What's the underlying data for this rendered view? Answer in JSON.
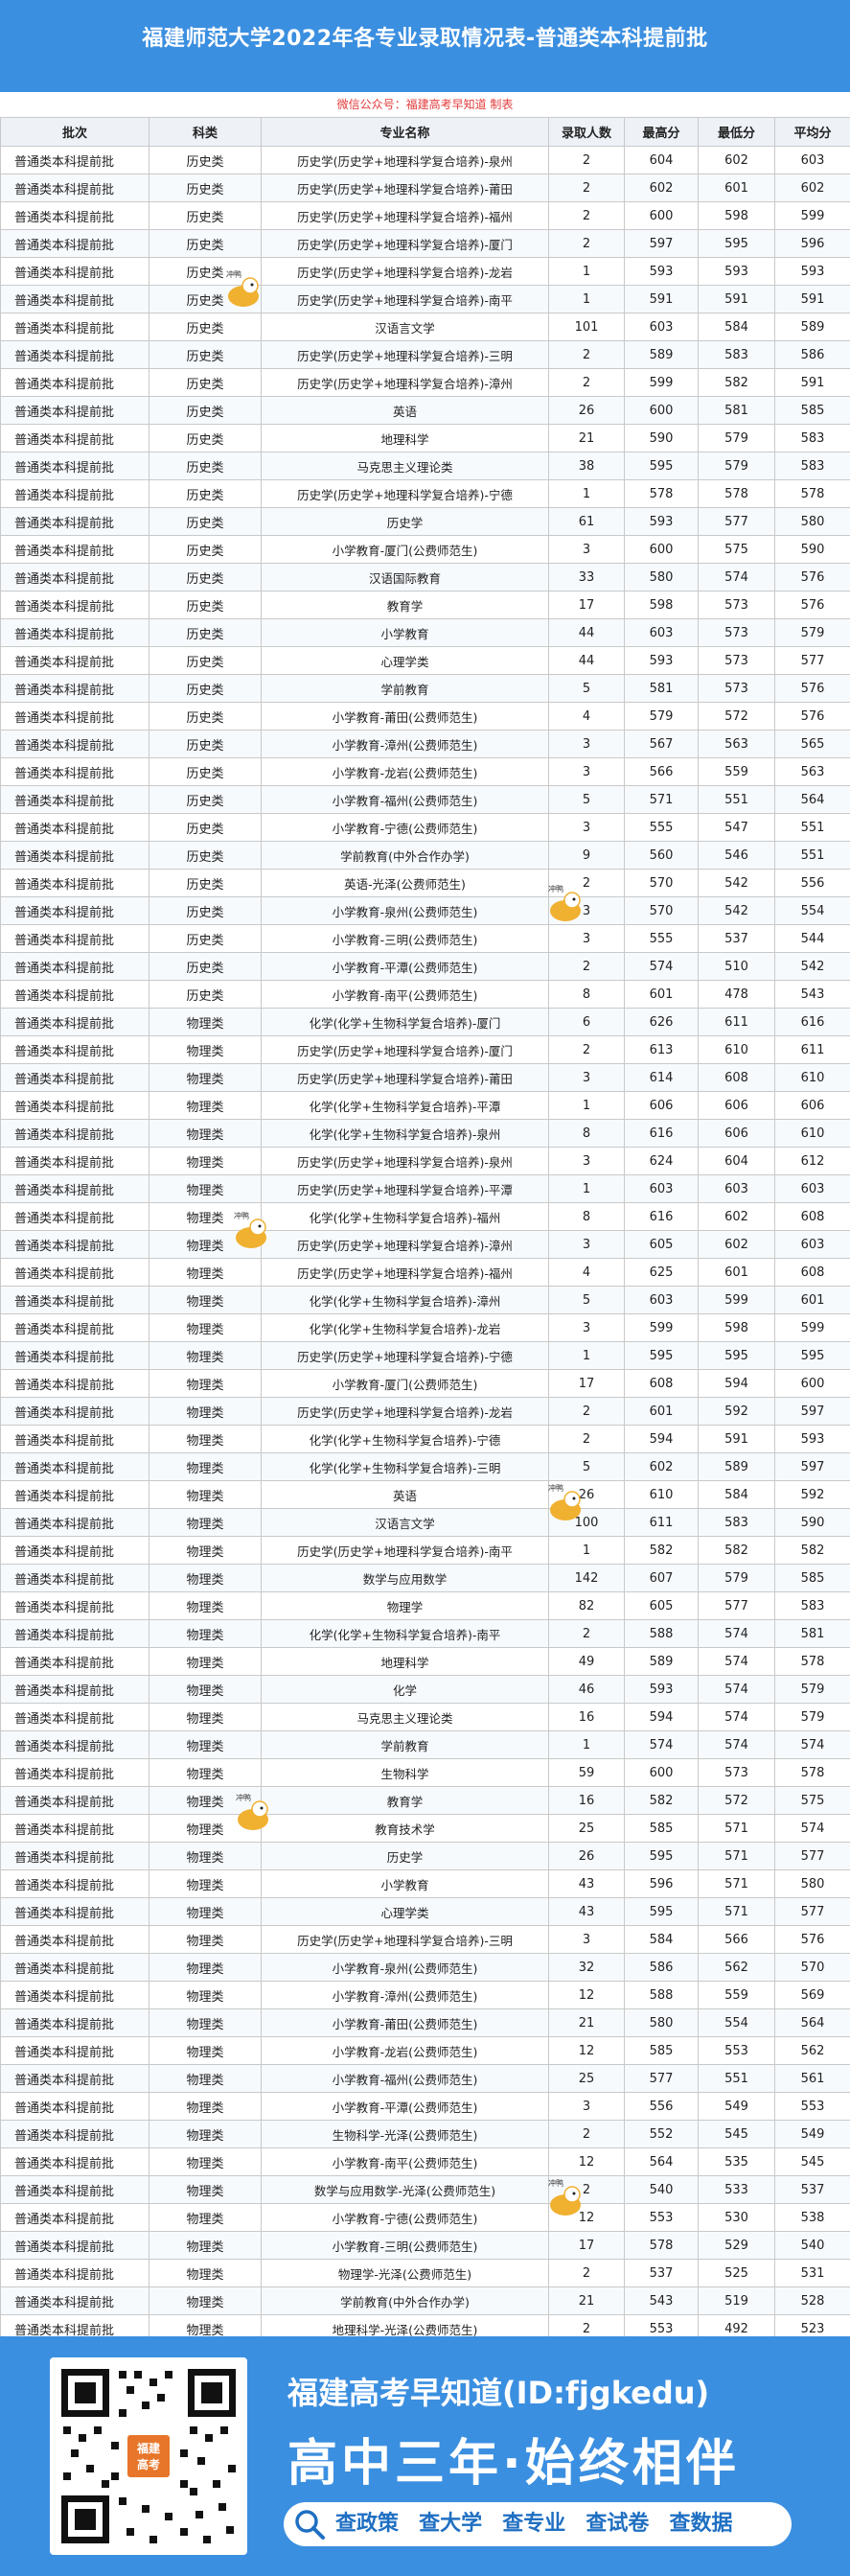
{
  "header": {
    "title": "福建师范大学2022年各专业录取情况表-普通类本科提前批",
    "subtitle": "微信公众号：福建高考早知道 制表"
  },
  "table": {
    "columns": [
      "批次",
      "科类",
      "专业名称",
      "录取人数",
      "最高分",
      "最低分",
      "平均分"
    ],
    "rows": [
      [
        "普通类本科提前批",
        "历史类",
        "历史学(历史学+地理科学复合培养)-泉州",
        "2",
        "604",
        "602",
        "603"
      ],
      [
        "普通类本科提前批",
        "历史类",
        "历史学(历史学+地理科学复合培养)-莆田",
        "2",
        "602",
        "601",
        "602"
      ],
      [
        "普通类本科提前批",
        "历史类",
        "历史学(历史学+地理科学复合培养)-福州",
        "2",
        "600",
        "598",
        "599"
      ],
      [
        "普通类本科提前批",
        "历史类",
        "历史学(历史学+地理科学复合培养)-厦门",
        "2",
        "597",
        "595",
        "596"
      ],
      [
        "普通类本科提前批",
        "历史类",
        "历史学(历史学+地理科学复合培养)-龙岩",
        "1",
        "593",
        "593",
        "593"
      ],
      [
        "普通类本科提前批",
        "历史类",
        "历史学(历史学+地理科学复合培养)-南平",
        "1",
        "591",
        "591",
        "591"
      ],
      [
        "普通类本科提前批",
        "历史类",
        "汉语言文学",
        "101",
        "603",
        "584",
        "589"
      ],
      [
        "普通类本科提前批",
        "历史类",
        "历史学(历史学+地理科学复合培养)-三明",
        "2",
        "589",
        "583",
        "586"
      ],
      [
        "普通类本科提前批",
        "历史类",
        "历史学(历史学+地理科学复合培养)-漳州",
        "2",
        "599",
        "582",
        "591"
      ],
      [
        "普通类本科提前批",
        "历史类",
        "英语",
        "26",
        "600",
        "581",
        "585"
      ],
      [
        "普通类本科提前批",
        "历史类",
        "地理科学",
        "21",
        "590",
        "579",
        "583"
      ],
      [
        "普通类本科提前批",
        "历史类",
        "马克思主义理论类",
        "38",
        "595",
        "579",
        "583"
      ],
      [
        "普通类本科提前批",
        "历史类",
        "历史学(历史学+地理科学复合培养)-宁德",
        "1",
        "578",
        "578",
        "578"
      ],
      [
        "普通类本科提前批",
        "历史类",
        "历史学",
        "61",
        "593",
        "577",
        "580"
      ],
      [
        "普通类本科提前批",
        "历史类",
        "小学教育-厦门(公费师范生)",
        "3",
        "600",
        "575",
        "590"
      ],
      [
        "普通类本科提前批",
        "历史类",
        "汉语国际教育",
        "33",
        "580",
        "574",
        "576"
      ],
      [
        "普通类本科提前批",
        "历史类",
        "教育学",
        "17",
        "598",
        "573",
        "576"
      ],
      [
        "普通类本科提前批",
        "历史类",
        "小学教育",
        "44",
        "603",
        "573",
        "579"
      ],
      [
        "普通类本科提前批",
        "历史类",
        "心理学类",
        "44",
        "593",
        "573",
        "577"
      ],
      [
        "普通类本科提前批",
        "历史类",
        "学前教育",
        "5",
        "581",
        "573",
        "576"
      ],
      [
        "普通类本科提前批",
        "历史类",
        "小学教育-莆田(公费师范生)",
        "4",
        "579",
        "572",
        "576"
      ],
      [
        "普通类本科提前批",
        "历史类",
        "小学教育-漳州(公费师范生)",
        "3",
        "567",
        "563",
        "565"
      ],
      [
        "普通类本科提前批",
        "历史类",
        "小学教育-龙岩(公费师范生)",
        "3",
        "566",
        "559",
        "563"
      ],
      [
        "普通类本科提前批",
        "历史类",
        "小学教育-福州(公费师范生)",
        "5",
        "571",
        "551",
        "564"
      ],
      [
        "普通类本科提前批",
        "历史类",
        "小学教育-宁德(公费师范生)",
        "3",
        "555",
        "547",
        "551"
      ],
      [
        "普通类本科提前批",
        "历史类",
        "学前教育(中外合作办学)",
        "9",
        "560",
        "546",
        "551"
      ],
      [
        "普通类本科提前批",
        "历史类",
        "英语-光泽(公费师范生)",
        "2",
        "570",
        "542",
        "556"
      ],
      [
        "普通类本科提前批",
        "历史类",
        "小学教育-泉州(公费师范生)",
        "3",
        "570",
        "542",
        "554"
      ],
      [
        "普通类本科提前批",
        "历史类",
        "小学教育-三明(公费师范生)",
        "3",
        "555",
        "537",
        "544"
      ],
      [
        "普通类本科提前批",
        "历史类",
        "小学教育-平潭(公费师范生)",
        "2",
        "574",
        "510",
        "542"
      ],
      [
        "普通类本科提前批",
        "历史类",
        "小学教育-南平(公费师范生)",
        "8",
        "601",
        "478",
        "543"
      ],
      [
        "普通类本科提前批",
        "物理类",
        "化学(化学+生物科学复合培养)-厦门",
        "6",
        "626",
        "611",
        "616"
      ],
      [
        "普通类本科提前批",
        "物理类",
        "历史学(历史学+地理科学复合培养)-厦门",
        "2",
        "613",
        "610",
        "611"
      ],
      [
        "普通类本科提前批",
        "物理类",
        "历史学(历史学+地理科学复合培养)-莆田",
        "3",
        "614",
        "608",
        "610"
      ],
      [
        "普通类本科提前批",
        "物理类",
        "化学(化学+生物科学复合培养)-平潭",
        "1",
        "606",
        "606",
        "606"
      ],
      [
        "普通类本科提前批",
        "物理类",
        "化学(化学+生物科学复合培养)-泉州",
        "8",
        "616",
        "606",
        "610"
      ],
      [
        "普通类本科提前批",
        "物理类",
        "历史学(历史学+地理科学复合培养)-泉州",
        "3",
        "624",
        "604",
        "612"
      ],
      [
        "普通类本科提前批",
        "物理类",
        "历史学(历史学+地理科学复合培养)-平潭",
        "1",
        "603",
        "603",
        "603"
      ],
      [
        "普通类本科提前批",
        "物理类",
        "化学(化学+生物科学复合培养)-福州",
        "8",
        "616",
        "602",
        "608"
      ],
      [
        "普通类本科提前批",
        "物理类",
        "历史学(历史学+地理科学复合培养)-漳州",
        "3",
        "605",
        "602",
        "603"
      ],
      [
        "普通类本科提前批",
        "物理类",
        "历史学(历史学+地理科学复合培养)-福州",
        "4",
        "625",
        "601",
        "608"
      ],
      [
        "普通类本科提前批",
        "物理类",
        "化学(化学+生物科学复合培养)-漳州",
        "5",
        "603",
        "599",
        "601"
      ],
      [
        "普通类本科提前批",
        "物理类",
        "化学(化学+生物科学复合培养)-龙岩",
        "3",
        "599",
        "598",
        "599"
      ],
      [
        "普通类本科提前批",
        "物理类",
        "历史学(历史学+地理科学复合培养)-宁德",
        "1",
        "595",
        "595",
        "595"
      ],
      [
        "普通类本科提前批",
        "物理类",
        "小学教育-厦门(公费师范生)",
        "17",
        "608",
        "594",
        "600"
      ],
      [
        "普通类本科提前批",
        "物理类",
        "历史学(历史学+地理科学复合培养)-龙岩",
        "2",
        "601",
        "592",
        "597"
      ],
      [
        "普通类本科提前批",
        "物理类",
        "化学(化学+生物科学复合培养)-宁德",
        "2",
        "594",
        "591",
        "593"
      ],
      [
        "普通类本科提前批",
        "物理类",
        "化学(化学+生物科学复合培养)-三明",
        "5",
        "602",
        "589",
        "597"
      ],
      [
        "普通类本科提前批",
        "物理类",
        "英语",
        "26",
        "610",
        "584",
        "592"
      ],
      [
        "普通类本科提前批",
        "物理类",
        "汉语言文学",
        "100",
        "611",
        "583",
        "590"
      ],
      [
        "普通类本科提前批",
        "物理类",
        "历史学(历史学+地理科学复合培养)-南平",
        "1",
        "582",
        "582",
        "582"
      ],
      [
        "普通类本科提前批",
        "物理类",
        "数学与应用数学",
        "142",
        "607",
        "579",
        "585"
      ],
      [
        "普通类本科提前批",
        "物理类",
        "物理学",
        "82",
        "605",
        "577",
        "583"
      ],
      [
        "普通类本科提前批",
        "物理类",
        "化学(化学+生物科学复合培养)-南平",
        "2",
        "588",
        "574",
        "581"
      ],
      [
        "普通类本科提前批",
        "物理类",
        "地理科学",
        "49",
        "589",
        "574",
        "578"
      ],
      [
        "普通类本科提前批",
        "物理类",
        "化学",
        "46",
        "593",
        "574",
        "579"
      ],
      [
        "普通类本科提前批",
        "物理类",
        "马克思主义理论类",
        "16",
        "594",
        "574",
        "579"
      ],
      [
        "普通类本科提前批",
        "物理类",
        "学前教育",
        "1",
        "574",
        "574",
        "574"
      ],
      [
        "普通类本科提前批",
        "物理类",
        "生物科学",
        "59",
        "600",
        "573",
        "578"
      ],
      [
        "普通类本科提前批",
        "物理类",
        "教育学",
        "16",
        "582",
        "572",
        "575"
      ],
      [
        "普通类本科提前批",
        "物理类",
        "教育技术学",
        "25",
        "585",
        "571",
        "574"
      ],
      [
        "普通类本科提前批",
        "物理类",
        "历史学",
        "26",
        "595",
        "571",
        "577"
      ],
      [
        "普通类本科提前批",
        "物理类",
        "小学教育",
        "43",
        "596",
        "571",
        "580"
      ],
      [
        "普通类本科提前批",
        "物理类",
        "心理学类",
        "43",
        "595",
        "571",
        "577"
      ],
      [
        "普通类本科提前批",
        "物理类",
        "历史学(历史学+地理科学复合培养)-三明",
        "3",
        "584",
        "566",
        "576"
      ],
      [
        "普通类本科提前批",
        "物理类",
        "小学教育-泉州(公费师范生)",
        "32",
        "586",
        "562",
        "570"
      ],
      [
        "普通类本科提前批",
        "物理类",
        "小学教育-漳州(公费师范生)",
        "12",
        "588",
        "559",
        "569"
      ],
      [
        "普通类本科提前批",
        "物理类",
        "小学教育-莆田(公费师范生)",
        "21",
        "580",
        "554",
        "564"
      ],
      [
        "普通类本科提前批",
        "物理类",
        "小学教育-龙岩(公费师范生)",
        "12",
        "585",
        "553",
        "562"
      ],
      [
        "普通类本科提前批",
        "物理类",
        "小学教育-福州(公费师范生)",
        "25",
        "577",
        "551",
        "561"
      ],
      [
        "普通类本科提前批",
        "物理类",
        "小学教育-平潭(公费师范生)",
        "3",
        "556",
        "549",
        "553"
      ],
      [
        "普通类本科提前批",
        "物理类",
        "生物科学-光泽(公费师范生)",
        "2",
        "552",
        "545",
        "549"
      ],
      [
        "普通类本科提前批",
        "物理类",
        "小学教育-南平(公费师范生)",
        "12",
        "564",
        "535",
        "545"
      ],
      [
        "普通类本科提前批",
        "物理类",
        "数学与应用数学-光泽(公费师范生)",
        "2",
        "540",
        "533",
        "537"
      ],
      [
        "普通类本科提前批",
        "物理类",
        "小学教育-宁德(公费师范生)",
        "12",
        "553",
        "530",
        "538"
      ],
      [
        "普通类本科提前批",
        "物理类",
        "小学教育-三明(公费师范生)",
        "17",
        "578",
        "529",
        "540"
      ],
      [
        "普通类本科提前批",
        "物理类",
        "物理学-光泽(公费师范生)",
        "2",
        "537",
        "525",
        "531"
      ],
      [
        "普通类本科提前批",
        "物理类",
        "学前教育(中外合作办学)",
        "21",
        "543",
        "519",
        "528"
      ],
      [
        "普通类本科提前批",
        "物理类",
        "地理科学-光泽(公费师范生)",
        "2",
        "553",
        "492",
        "523"
      ]
    ]
  },
  "mascot": {
    "label": "冲鸭",
    "color": "#f0b030"
  },
  "footer": {
    "account": "福建高考早知道(ID:fjgkedu)",
    "slogan": "高中三年·始终相伴",
    "qr_badge": [
      "福建",
      "高考"
    ],
    "links": [
      "查政策",
      "查大学",
      "查专业",
      "查试卷",
      "查数据"
    ]
  },
  "colors": {
    "header_bg": "#3b8fe0",
    "subtitle": "#e23b3b",
    "link": "#1f6fc2"
  }
}
